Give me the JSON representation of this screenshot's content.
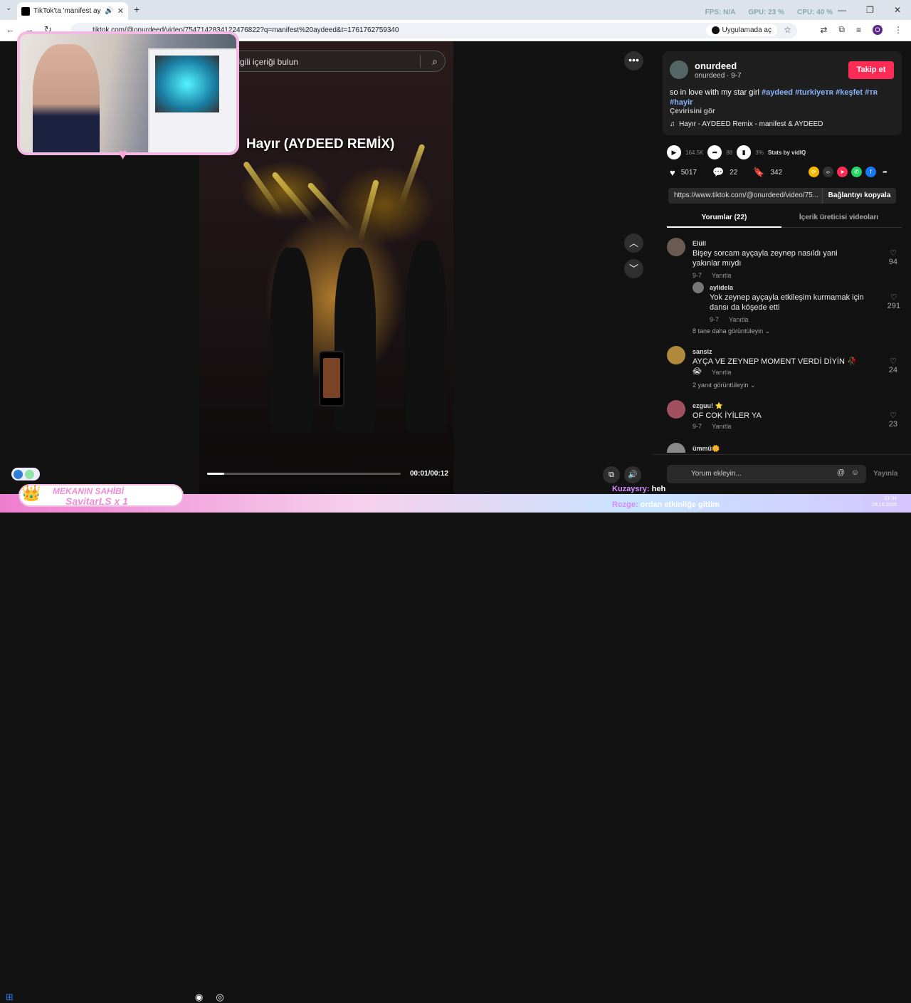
{
  "browser": {
    "tab_title": "TikTok'ta 'manifest aydeed'",
    "address": "tiktok.com/@onurdeed/video/7547142834122476822?q=manifest%20aydeed&t=1761762759340",
    "open_in_app": "Uygulamada aç",
    "stats": {
      "fps": "FPS: N/A",
      "gpu": "GPU: 23 %",
      "cpu": "CPU: 40 %"
    },
    "profile_initial": "O"
  },
  "search": {
    "placeholder": "İlgili içeriği bulun"
  },
  "video": {
    "title": "Hayır (AYDEED REMİX)",
    "time": "00:01/00:12",
    "progress": 0.09
  },
  "post": {
    "username": "onurdeed",
    "subline": "onurdeed · 9-7",
    "follow": "Takip et",
    "caption": "so in love with my star girl",
    "tags": [
      "#aydeed",
      "#turkiyeᴛʀ",
      "#keşfet",
      "#ᴛʀ",
      "#hayir"
    ],
    "see_translation": "Çevirisini gör",
    "music": "Hayır - AYDEED Remix - manifest & AYDEED"
  },
  "vidiq": {
    "views": "164.5K",
    "shares_stat": "88",
    "percent": "3%",
    "label": "Stats by vidIQ"
  },
  "actions": {
    "likes": "5017",
    "comments": "22",
    "saves": "342"
  },
  "link": {
    "url": "https://www.tiktok.com/@onurdeed/video/75...",
    "copy": "Bağlantıyı kopyala"
  },
  "tabs": {
    "comments": "Yorumlar (22)",
    "creator_videos": "İçerik üreticisi videoları"
  },
  "comments": [
    {
      "name": "Elüll",
      "text": "Bişey sorcam ayçayla zeynep nasıldı yani yakınlar mıydı",
      "date": "9-7",
      "reply": "Yanıtla",
      "likes": "94"
    },
    {
      "name": "aylidela",
      "text": "Yok zeynep ayçayla etkileşim kurmamak için dansı da köşede etti",
      "date": "9-7",
      "reply": "Yanıtla",
      "likes": "291"
    },
    {
      "name": "sansiz",
      "text": "AYÇA VE ZEYNEP MOMENT VERDİ DİYİN 🥀😭",
      "date": "9-7",
      "reply": "Yanıtla",
      "likes": "24"
    },
    {
      "name": "ezguu! ⭐",
      "text": "OF COK İYİLER YA",
      "date": "9-7",
      "reply": "Yanıtla",
      "likes": "23"
    },
    {
      "name": "ümmü🌼",
      "text": "",
      "date": "",
      "reply": "",
      "likes": ""
    }
  ],
  "more_replies": [
    "8 tane daha görüntüleyin ⌄",
    "2 yanıt görüntüleyin ⌄"
  ],
  "comment_input": {
    "placeholder": "Yorum ekleyin...",
    "post": "Yayınla"
  },
  "overlay": {
    "banner_line1": "MEKANIN SAHİBİ",
    "banner_line2": "SavitarLS x 1",
    "chat1_user": "Kuzaysry:",
    "chat1_msg": "heh",
    "chat2_user": "Rozge:",
    "chat2_msg": "ordan etkinliğe gittim"
  },
  "clock": {
    "time": "21:34",
    "date": "29.10.2025"
  }
}
